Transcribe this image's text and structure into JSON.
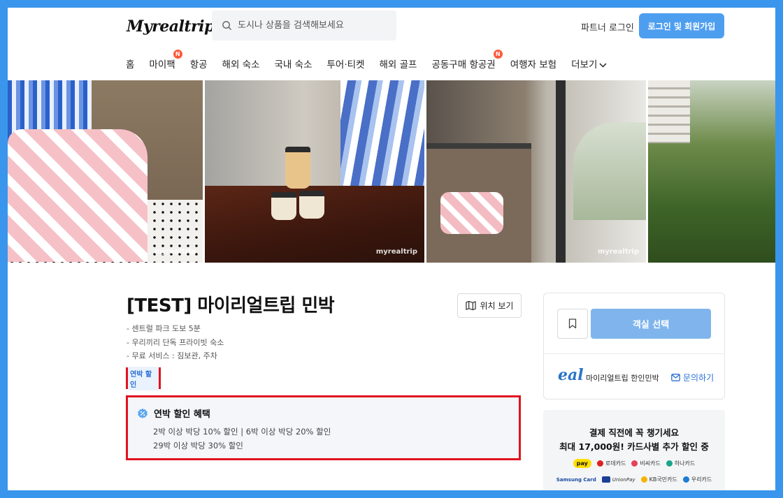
{
  "header": {
    "logo": "Myrealtrip",
    "search_placeholder": "도시나 상품을 검색해보세요",
    "partner_login": "파트너 로그인",
    "login_button": "로그인 및 회원가입"
  },
  "nav": {
    "items": [
      {
        "label": "홈"
      },
      {
        "label": "마이팩",
        "badge": "N"
      },
      {
        "label": "항공"
      },
      {
        "label": "해외 숙소"
      },
      {
        "label": "국내 숙소"
      },
      {
        "label": "투어·티켓"
      },
      {
        "label": "해외 골프"
      },
      {
        "label": "공동구매 항공권",
        "badge": "N"
      },
      {
        "label": "여행자 보험"
      },
      {
        "label": "더보기"
      }
    ]
  },
  "gallery": {
    "watermark": "myrealtrip"
  },
  "listing": {
    "title": "[TEST] 마이리얼트립 민박",
    "map_button": "위치 보기",
    "description": [
      "- 센트럴 파크 도보 5분",
      "- 우리끼리 단독 프라이빗 숙소",
      "- 무료 서비스 : 짐보관, 주차"
    ],
    "tag": "연박 할인",
    "benefit": {
      "title": "연박 할인 혜택",
      "line1": "2박 이상 박당 10% 할인 | 6박 이상 박당 20% 할인",
      "line2": "29박 이상 박당 30% 할인"
    }
  },
  "booking_card": {
    "select_room": "객실 선택",
    "host_logo": "eal",
    "host_name": "마이리얼트립 한인민박",
    "inquiry": "문의하기"
  },
  "promo": {
    "line1": "결제 직전에 꼭 챙기세요",
    "line2": "최대 17,000원! 카드사별 추가 할인 중",
    "row1": [
      "pay",
      "로데카드",
      "비씨카드",
      "하나카드"
    ],
    "row2": [
      "Samsung Card",
      "UnionPay",
      "KB국민카드",
      "우리카드"
    ]
  },
  "colors": {
    "accent": "#4e9ef0",
    "room_button": "#7fb5ec",
    "highlight_border": "#e0121f",
    "frame": "#3a96ec"
  }
}
